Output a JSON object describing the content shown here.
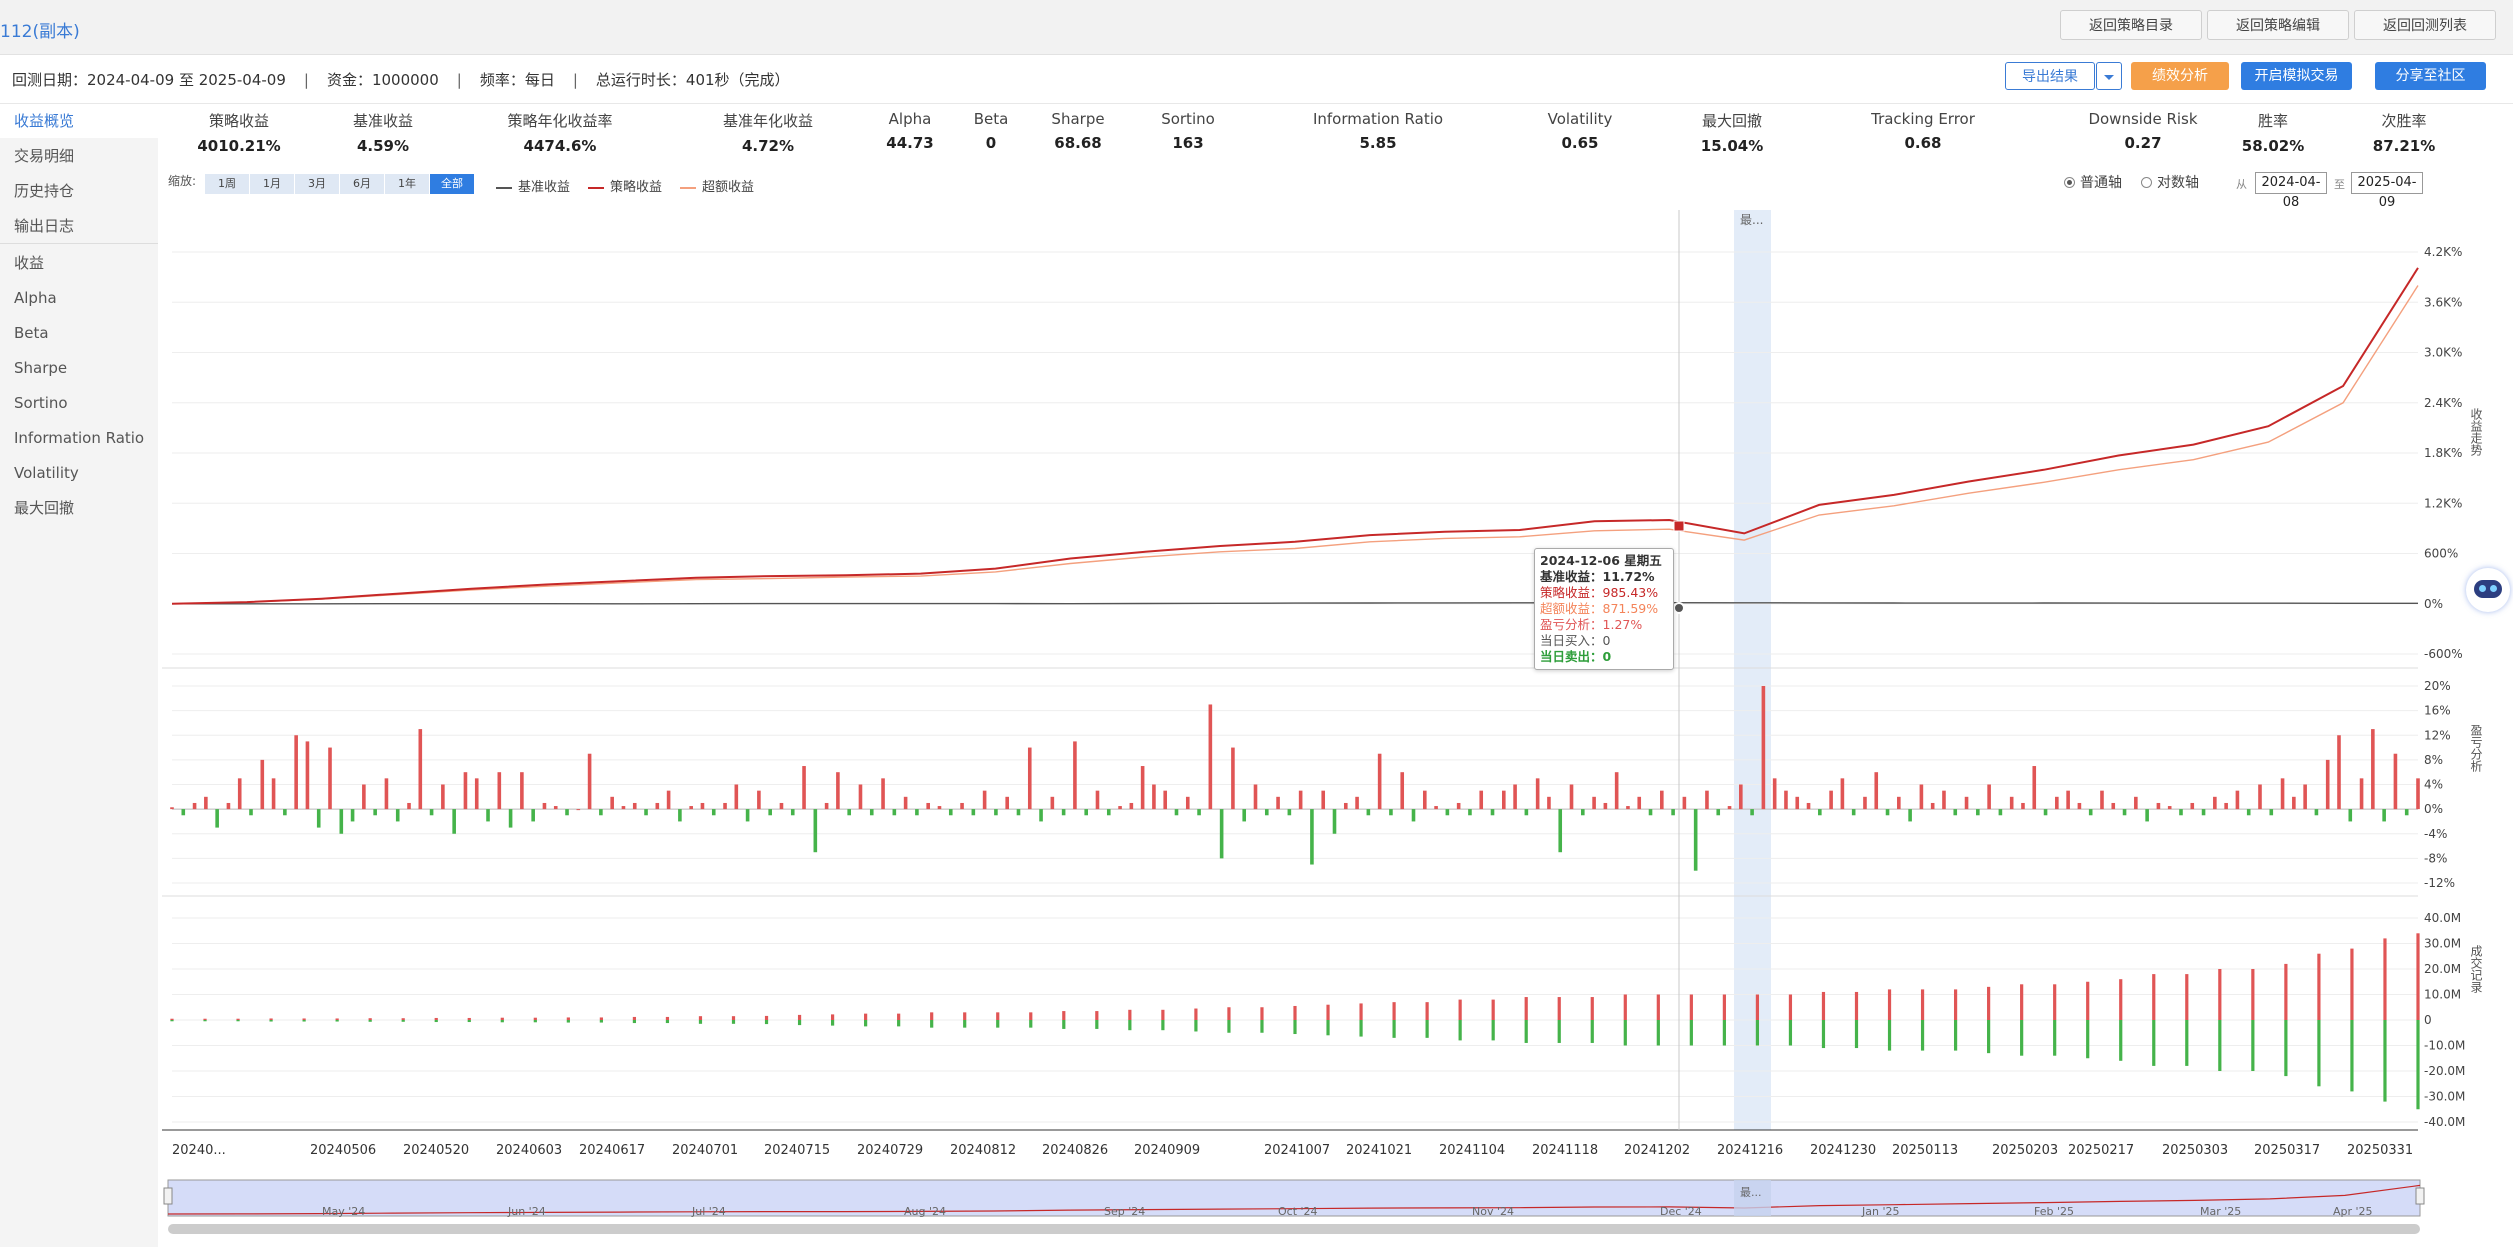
{
  "window": {
    "title": "112(副本)"
  },
  "top_buttons": {
    "back_strategy_list": "返回策略目录",
    "back_strategy_edit": "返回策略编辑",
    "back_backtest_list": "返回回测列表"
  },
  "info": {
    "dates": "回测日期：2024-04-09 至 2025-04-09",
    "capital": "资金：1000000",
    "frequency": "频率：每日",
    "runtime": "总运行时长：401秒（完成）",
    "separator": "|"
  },
  "actions": {
    "export": "导出结果",
    "perf_analysis": "绩效分析",
    "sim_trade": "开启模拟交易",
    "share": "分享至社区"
  },
  "colors": {
    "accent": "#2f7de1",
    "orange": "#f5a04a",
    "red": "#e05555",
    "green": "#45b34a",
    "strategy_line": "#c62828",
    "excess_line": "#f4a07e",
    "benchmark_line": "#555555"
  },
  "sidebar": {
    "items": [
      "收益概览",
      "交易明细",
      "历史持仓",
      "输出日志",
      "收益",
      "Alpha",
      "Beta",
      "Sharpe",
      "Sortino",
      "Information Ratio",
      "Volatility",
      "最大回撤"
    ],
    "active": "收益概览"
  },
  "metrics": [
    {
      "label": "策略收益",
      "value": "4010.21%"
    },
    {
      "label": "基准收益",
      "value": "4.59%"
    },
    {
      "label": "策略年化收益率",
      "value": "4474.6%"
    },
    {
      "label": "基准年化收益",
      "value": "4.72%"
    },
    {
      "label": "Alpha",
      "value": "44.73"
    },
    {
      "label": "Beta",
      "value": "0"
    },
    {
      "label": "Sharpe",
      "value": "68.68"
    },
    {
      "label": "Sortino",
      "value": "163"
    },
    {
      "label": "Information Ratio",
      "value": "5.85"
    },
    {
      "label": "Volatility",
      "value": "0.65"
    },
    {
      "label": "最大回撤",
      "value": "15.04%"
    },
    {
      "label": "Tracking Error",
      "value": "0.68"
    },
    {
      "label": "Downside Risk",
      "value": "0.27"
    },
    {
      "label": "胜率",
      "value": "58.02%"
    },
    {
      "label": "次胜率",
      "value": "87.21%"
    }
  ],
  "zoom": {
    "label": "缩放:",
    "buttons": [
      "1周",
      "1月",
      "3月",
      "6月",
      "1年",
      "全部"
    ],
    "active": "全部"
  },
  "legend": {
    "items": [
      "基准收益",
      "策略收益",
      "超额收益"
    ]
  },
  "axis_mode": {
    "options": [
      "普通轴",
      "对数轴"
    ],
    "selected": "普通轴"
  },
  "date_range": {
    "from_label": "从",
    "to_label": "至",
    "from": "2024-04-08",
    "to": "2025-04-09"
  },
  "panel_labels": {
    "top": "收益走势",
    "mid": "盈亏分析",
    "bot": "成交记录"
  },
  "highlight_label": "最...",
  "tooltip": {
    "date": "2024-12-06 星期五",
    "lines": [
      {
        "label": "基准收益：",
        "value": "11.72%",
        "color": "#333333"
      },
      {
        "label": "策略收益：",
        "value": "985.43%",
        "color": "#c62828"
      },
      {
        "label": "超额收益：",
        "value": "871.59%",
        "color": "#f4845a"
      },
      {
        "label": "盈亏分析：",
        "value": "1.27%",
        "color": "#e05555"
      },
      {
        "label": "当日买入：",
        "value": "0",
        "color": "#555555"
      },
      {
        "label": "当日卖出：",
        "value": "0",
        "color": "#2e9e3a"
      }
    ]
  },
  "chart_data": [
    {
      "type": "line",
      "title": "",
      "ylim": [
        -600,
        4200
      ],
      "y_ticks": [
        "4.2K%",
        "3.6K%",
        "3.0K%",
        "2.4K%",
        "1.8K%",
        "1.2K%",
        "600%",
        "0%",
        "-600%"
      ],
      "y_tick_values": [
        4200,
        3600,
        3000,
        2400,
        1800,
        1200,
        600,
        0,
        -600
      ],
      "x_ticks": [
        "20240...",
        "20240506",
        "20240520",
        "20240603",
        "20240617",
        "20240701",
        "20240715",
        "20240729",
        "20240812",
        "20240826",
        "20240909",
        "20241007",
        "20241021",
        "20241104",
        "20241118",
        "20241202",
        "20241216",
        "20241230",
        "20250113",
        "20250203",
        "20250217",
        "20250303",
        "20250317",
        "20250331"
      ],
      "series": [
        {
          "name": "基准收益",
          "values": [
            0,
            0,
            0,
            1,
            1,
            1,
            0,
            1,
            2,
            2,
            2,
            2,
            1,
            3,
            5,
            8,
            9,
            10,
            11,
            11,
            12,
            11,
            10,
            9,
            8,
            9,
            8,
            7,
            6,
            5,
            5
          ]
        },
        {
          "name": "策略收益",
          "values": [
            0,
            20,
            60,
            120,
            180,
            230,
            270,
            310,
            330,
            340,
            360,
            420,
            540,
            620,
            690,
            740,
            820,
            860,
            880,
            985,
            1000,
            840,
            1180,
            1300,
            1460,
            1600,
            1770,
            1900,
            2120,
            2600,
            4010
          ]
        },
        {
          "name": "超额收益",
          "values": [
            0,
            18,
            55,
            110,
            165,
            210,
            250,
            290,
            300,
            320,
            330,
            380,
            480,
            560,
            620,
            660,
            740,
            780,
            800,
            871,
            890,
            760,
            1060,
            1170,
            1320,
            1450,
            1600,
            1720,
            1930,
            2400,
            3800
          ]
        }
      ]
    },
    {
      "type": "bar",
      "title": "",
      "ylim": [
        -12,
        20
      ],
      "y_ticks": [
        "20%",
        "16%",
        "12%",
        "8%",
        "4%",
        "0%",
        "-4%",
        "-8%",
        "-12%"
      ],
      "y_tick_values": [
        20,
        16,
        12,
        8,
        4,
        0,
        -4,
        -8,
        -12
      ],
      "values": [
        0.3,
        -1,
        1,
        2,
        -3,
        1,
        5,
        -1,
        8,
        5,
        -1,
        12,
        11,
        -3,
        10,
        -4,
        -2,
        4,
        -1,
        5,
        -2,
        1,
        13,
        -1,
        4,
        -4,
        6,
        5,
        -2,
        6,
        -3,
        6,
        -2,
        1,
        0.5,
        -1,
        0,
        9,
        -1,
        2,
        0.5,
        1,
        -1,
        1,
        3,
        -2,
        0.5,
        1,
        -1,
        1,
        4,
        -2,
        3,
        -1,
        1,
        -1,
        7,
        -7,
        1,
        6,
        -1,
        4,
        -1,
        5,
        -1,
        2,
        -1,
        1,
        0.5,
        -1,
        1,
        -1,
        3,
        -1,
        2,
        -1,
        10,
        -2,
        2,
        -1,
        11,
        -1,
        3,
        -1,
        0.5,
        1,
        7,
        4,
        3,
        -1,
        2,
        -1,
        17,
        -8,
        10,
        -2,
        4,
        -1,
        2,
        -1,
        3,
        -9,
        3,
        -4,
        1,
        2,
        -1,
        9,
        -1,
        6,
        -2,
        3,
        0.5,
        -1,
        1,
        -1,
        3,
        -1,
        3,
        4,
        -1,
        5,
        2,
        -7,
        4,
        -1,
        2,
        1,
        6,
        0.5,
        2,
        -1,
        3,
        -1,
        2,
        -10,
        3,
        -1,
        0.5,
        4,
        -1,
        20,
        5,
        3,
        2,
        1,
        -1,
        3,
        5,
        -1,
        2,
        6,
        -1,
        2,
        -2,
        4,
        1,
        3,
        -1,
        2,
        -1,
        4,
        -1,
        2,
        1,
        7,
        -1,
        2,
        3,
        1,
        -1,
        3,
        1,
        -1,
        2,
        -2,
        1,
        0.5,
        -1,
        1,
        -1,
        2,
        1,
        3,
        -1,
        4,
        -1,
        5,
        2,
        4,
        -1,
        8,
        12,
        -2,
        5,
        13,
        -2,
        9,
        -1,
        5
      ],
      "highlight_value": 1.27
    },
    {
      "type": "bar",
      "title": "",
      "ylim": [
        -40,
        40
      ],
      "y_ticks": [
        "40.0M",
        "30.0M",
        "20.0M",
        "10.0M",
        "0",
        "-10.0M",
        "-20.0M",
        "-30.0M",
        "-40.0M"
      ],
      "y_tick_values": [
        40,
        30,
        20,
        10,
        0,
        -10,
        -20,
        -30,
        -40
      ],
      "buy_values": [
        0.5,
        0.5,
        0.5,
        0.6,
        0.6,
        0.6,
        0.7,
        0.7,
        0.8,
        0.8,
        0.9,
        0.9,
        1,
        1,
        1.2,
        1.2,
        1.5,
        1.5,
        1.6,
        2,
        2.2,
        2.5,
        2.5,
        3,
        3,
        3,
        3,
        3.5,
        3.5,
        4,
        4,
        4.5,
        5,
        5,
        5.5,
        6,
        6.5,
        7,
        7,
        8,
        8,
        9,
        9,
        9,
        10,
        10,
        10,
        10,
        10,
        10,
        11,
        11,
        12,
        12,
        12,
        13,
        14,
        14,
        15,
        16,
        18,
        18,
        20,
        20,
        22,
        26,
        28,
        32,
        34
      ],
      "sell_values": [
        -0.5,
        -0.5,
        -0.5,
        -0.6,
        -0.6,
        -0.6,
        -0.7,
        -0.7,
        -0.8,
        -0.8,
        -0.9,
        -0.9,
        -1,
        -1,
        -1.2,
        -1.2,
        -1.5,
        -1.5,
        -1.6,
        -2,
        -2.2,
        -2.5,
        -2.5,
        -3,
        -3,
        -3,
        -3,
        -3.5,
        -3.5,
        -4,
        -4,
        -4.5,
        -5,
        -5,
        -5.5,
        -6,
        -6.5,
        -7,
        -7,
        -8,
        -8,
        -9,
        -9,
        -9,
        -10,
        -10,
        -10,
        -10,
        -10,
        -10,
        -11,
        -11,
        -12,
        -12,
        -12,
        -13,
        -14,
        -14,
        -15,
        -16,
        -18,
        -18,
        -20,
        -20,
        -22,
        -26,
        -28,
        -32,
        -35
      ]
    }
  ],
  "navigator": {
    "labels": [
      "May '24",
      "Jun '24",
      "Jul '24",
      "Aug '24",
      "Sep '24",
      "Oct '24",
      "Nov '24",
      "Dec '24",
      "Jan '25",
      "Feb '25",
      "Mar '25",
      "Apr '25"
    ]
  }
}
